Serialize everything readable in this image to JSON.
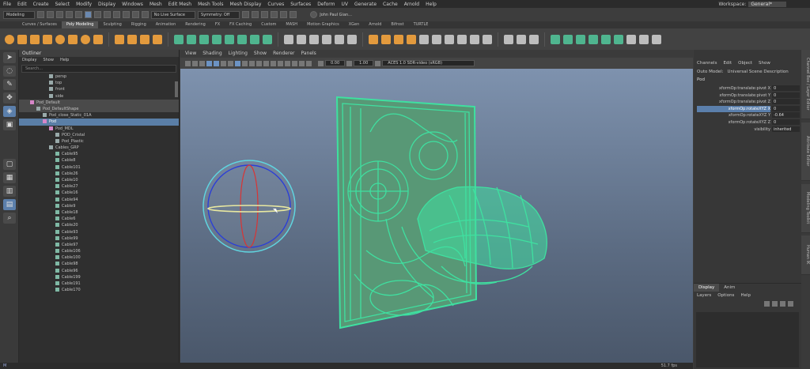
{
  "menubar": {
    "items": [
      "File",
      "Edit",
      "Create",
      "Select",
      "Modify",
      "Display",
      "Windows",
      "Mesh",
      "Edit Mesh",
      "Mesh Tools",
      "Mesh Display",
      "Curves",
      "Surfaces",
      "Deform",
      "UV",
      "Generate",
      "Cache",
      "Arnold",
      "Help"
    ],
    "workspace_label": "Workspace:",
    "workspace_value": "General*"
  },
  "statusline": {
    "mode": "Modeling",
    "live_surface": "No Live Surface",
    "symmetry": "Symmetry: Off",
    "user": "John Paul Gian..."
  },
  "shelf_tabs": [
    "Curves / Surfaces",
    "Poly Modeling",
    "Sculpting",
    "Rigging",
    "Animation",
    "Rendering",
    "FX",
    "FX Caching",
    "Custom",
    "MASH",
    "Motion Graphics",
    "XGen",
    "Arnold",
    "Bifrost",
    "TURTLE"
  ],
  "shelf_active": "Poly Modeling",
  "outliner": {
    "title": "Outliner",
    "menu": [
      "Display",
      "Show",
      "Help"
    ],
    "search_placeholder": "Search...",
    "rows": [
      "persp",
      "top",
      "front",
      "side",
      "Pod_Default",
      "Pod_DefaultShape",
      "Pod_close_Static_01A",
      "Pod",
      "Pod_MDL",
      "POD_Cristal",
      "Pod_Plastic",
      "Cables_GRP",
      "Cable95",
      "Cable8",
      "Cable101",
      "Cable26",
      "Cable10",
      "Cable27",
      "Cable16",
      "Cable94",
      "Cable9",
      "Cable18",
      "Cable6",
      "Cable20",
      "Cable93",
      "Cable99",
      "Cable97",
      "Cable106",
      "Cable100",
      "Cable98",
      "Cable96",
      "Cable199",
      "Cable191",
      "Cable170"
    ]
  },
  "viewport": {
    "menu": [
      "View",
      "Shading",
      "Lighting",
      "Show",
      "Renderer",
      "Panels"
    ],
    "near": "0.00",
    "far": "1.00",
    "colorspace": "ACES 1.0 SDR-video (sRGB)",
    "fps": "51.7 fps"
  },
  "channel_box": {
    "menu": [
      "Channels",
      "Edit",
      "Object",
      "Show"
    ],
    "submenu": [
      "Outo Model:",
      "Universal Scene Description"
    ],
    "object": "Pod",
    "rows": [
      {
        "label": "xformOp:translate:pivot X",
        "value": "0"
      },
      {
        "label": "xformOp:translate:pivot Y",
        "value": "0"
      },
      {
        "label": "xformOp:translate:pivot Z",
        "value": "0"
      },
      {
        "label": "xformOp:rotateXYZ X",
        "value": "0"
      },
      {
        "label": "xformOp:rotateXYZ Y",
        "value": "-0.64"
      },
      {
        "label": "xformOp:rotateXYZ Z",
        "value": "0"
      },
      {
        "label": "visibility",
        "value": "inherited"
      }
    ],
    "selected_row": 3
  },
  "layer_editor": {
    "tabs": [
      "Display",
      "Anim"
    ],
    "menu": [
      "Layers",
      "Options",
      "Help"
    ]
  },
  "side_tabs": [
    "Channel Box / Layer Editor",
    "Attribute Editor",
    "Modeling Toolkit",
    "Human IK"
  ],
  "colors": {
    "accent": "#5a7ea6",
    "wireframe": "#3fe0a0",
    "shelf_orange": "#e39a3d"
  }
}
